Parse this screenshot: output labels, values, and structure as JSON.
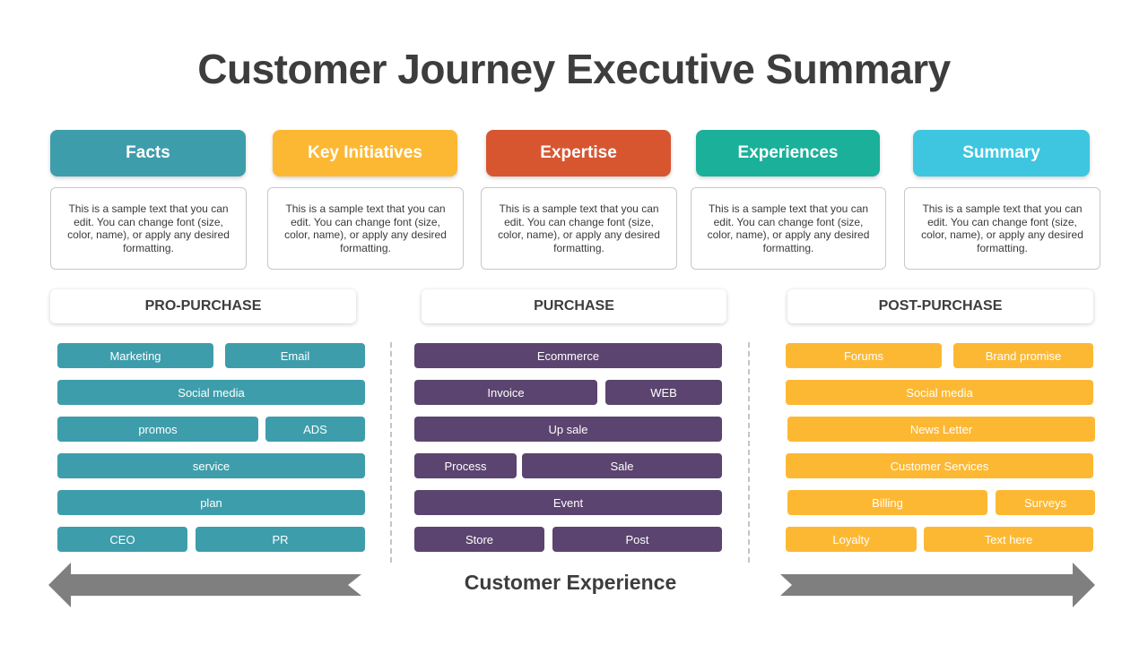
{
  "title": "Customer Journey Executive Summary",
  "colors": {
    "facts": "#3e9dab",
    "key_initiatives": "#fdb833",
    "expertise": "#d75630",
    "experiences": "#1bb09a",
    "summary": "#3ec6e0",
    "pre_purchase": "#3e9dab",
    "purchase": "#5b446f",
    "post_purchase": "#fdb833",
    "arrow": "#7f7f7f"
  },
  "categories": [
    {
      "label": "Facts",
      "text": "This is a sample text that you can edit. You can change font (size, color, name), or apply any desired formatting."
    },
    {
      "label": "Key Initiatives",
      "text": "This is a sample text that you can edit. You can change font (size, color, name), or apply any desired formatting."
    },
    {
      "label": "Expertise",
      "text": "This is a sample text that you can edit. You can change font (size, color, name), or apply any desired formatting."
    },
    {
      "label": "Experiences",
      "text": "This is a sample text that you can edit. You can change font (size, color, name), or apply any desired formatting."
    },
    {
      "label": "Summary",
      "text": "This is a sample text that you can edit. You can change font (size, color, name), or apply any desired formatting."
    }
  ],
  "stages": [
    {
      "label": "PRO-PURCHASE",
      "items": [
        "Marketing",
        "Email",
        "Social media",
        "promos",
        "ADS",
        "service",
        "plan",
        "CEO",
        "PR"
      ]
    },
    {
      "label": "PURCHASE",
      "items": [
        "Ecommerce",
        "Invoice",
        "WEB",
        "Up sale",
        "Process",
        "Sale",
        "Event",
        "Store",
        "Post"
      ]
    },
    {
      "label": "POST-PURCHASE",
      "items": [
        "Forums",
        "Brand promise",
        "Social media",
        "News Letter",
        "Customer Services",
        "Billing",
        "Surveys",
        "Loyalty",
        "Text here"
      ]
    }
  ],
  "footer": {
    "label": "Customer Experience",
    "left_arrow": "arrow-left",
    "right_arrow": "arrow-right"
  }
}
